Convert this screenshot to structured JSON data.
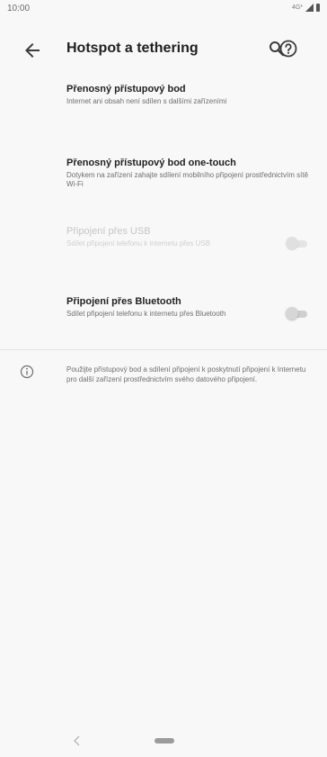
{
  "status_bar": {
    "time": "10:00",
    "network": "4G*"
  },
  "app_bar": {
    "title": "Hotspot a tethering",
    "back_icon": "arrow-back-icon",
    "search_icon": "search-icon",
    "help_icon": "help-icon"
  },
  "settings": {
    "items": [
      {
        "title": "Přenosný přístupový bod",
        "summary": "Internet ani obsah není sdílen s dalšími zařízeními"
      },
      {
        "title": "Přenosný přístupový bod one-touch",
        "summary": "Dotykem na zařízení zahajte sdílení mobilního připojení prostřednictvím sítě Wi-Fi"
      },
      {
        "title": "Připojení přes USB",
        "summary": "Sdílet připojení telefonu k internetu přes USB",
        "enabled": false,
        "switch_on": false
      },
      {
        "title": "Připojení přes Bluetooth",
        "summary": "Sdílet připojení telefonu k internetu přes Bluetooth",
        "enabled": true,
        "switch_on": false
      }
    ]
  },
  "info": {
    "icon": "info-icon",
    "text": "Použijte přístupový bod a sdílení připojení k poskytnutí připojení k Internetu pro další zařízení prostřednictvím svého datového připojení."
  },
  "colors": {
    "background": "#f8f8f8",
    "text_primary": "#202124",
    "text_secondary": "#6e6e6e",
    "switch_off": "#d6d6d6"
  }
}
